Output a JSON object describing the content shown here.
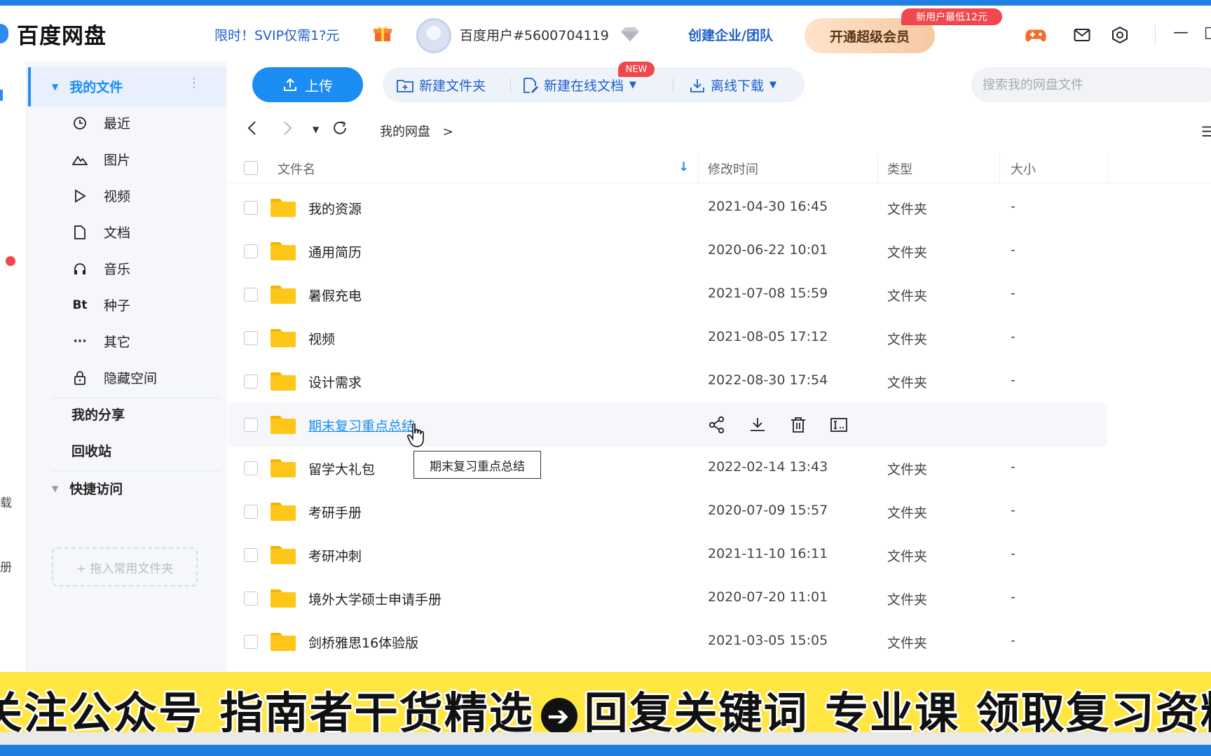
{
  "app": {
    "title": "百度网盘"
  },
  "header": {
    "promo": "限时！SVIP仅需1?元",
    "user_name": "百度用户#5600704119",
    "create_team": "创建企业/团队",
    "svip_button": "开通超级会员",
    "new_user_tag": "新用户最低12元"
  },
  "sidebar": {
    "my_files": "我的文件",
    "items": [
      {
        "label": "最近",
        "icon": "clock-icon"
      },
      {
        "label": "图片",
        "icon": "mountain-icon"
      },
      {
        "label": "视频",
        "icon": "play-icon"
      },
      {
        "label": "文档",
        "icon": "document-icon"
      },
      {
        "label": "音乐",
        "icon": "headphones-icon"
      },
      {
        "label": "种子",
        "icon": "bt-icon",
        "glyph": "Bt"
      },
      {
        "label": "其它",
        "icon": "more-icon",
        "glyph": "···"
      },
      {
        "label": "隐藏空间",
        "icon": "lock-icon"
      }
    ],
    "my_share": "我的分享",
    "recycle": "回收站",
    "quick_access": "快捷访问",
    "drop_hint": "+ 拖入常用文件夹"
  },
  "rail": {
    "text_a": "载",
    "text_b": "册"
  },
  "toolbar": {
    "upload": "上传",
    "new_folder": "新建文件夹",
    "new_online_doc": "新建在线文档",
    "new_badge": "NEW",
    "offline_download": "离线下载",
    "search_placeholder": "搜索我的网盘文件"
  },
  "nav": {
    "breadcrumb": "我的网盘",
    "breadcrumb_sep": ">"
  },
  "table": {
    "headers": {
      "name": "文件名",
      "modified": "修改时间",
      "type": "类型",
      "size": "大小"
    },
    "rows": [
      {
        "name": "我的资源",
        "modified": "2021-04-30 16:45",
        "type": "文件夹",
        "size": "-"
      },
      {
        "name": "通用简历",
        "modified": "2020-06-22 10:01",
        "type": "文件夹",
        "size": "-"
      },
      {
        "name": "暑假充电",
        "modified": "2021-07-08 15:59",
        "type": "文件夹",
        "size": "-"
      },
      {
        "name": "视频",
        "modified": "2021-08-05 17:12",
        "type": "文件夹",
        "size": "-"
      },
      {
        "name": "设计需求",
        "modified": "2022-08-30 17:54",
        "type": "文件夹",
        "size": "-"
      },
      {
        "name": "期末复习重点总结",
        "modified": "",
        "type": "",
        "size": ""
      },
      {
        "name": "留学大礼包",
        "modified": "2022-02-14 13:43",
        "type": "文件夹",
        "size": "-"
      },
      {
        "name": "考研手册",
        "modified": "2020-07-09 15:57",
        "type": "文件夹",
        "size": "-"
      },
      {
        "name": "考研冲刺",
        "modified": "2021-11-10 16:11",
        "type": "文件夹",
        "size": "-"
      },
      {
        "name": "境外大学硕士申请手册",
        "modified": "2020-07-20 11:01",
        "type": "文件夹",
        "size": "-"
      },
      {
        "name": "剑桥雅思16体验版",
        "modified": "2021-03-05 15:05",
        "type": "文件夹",
        "size": "-"
      }
    ],
    "tooltip": "期末复习重点总结"
  },
  "banner": {
    "part1": "关注公众号  指南者干货精选",
    "part2": "回复关键词  专业课  领取复习资料"
  },
  "colors": {
    "accent": "#1b8cf2",
    "folder": "#ffc61a",
    "banner": "#ffe640",
    "badge": "#f0474d"
  }
}
